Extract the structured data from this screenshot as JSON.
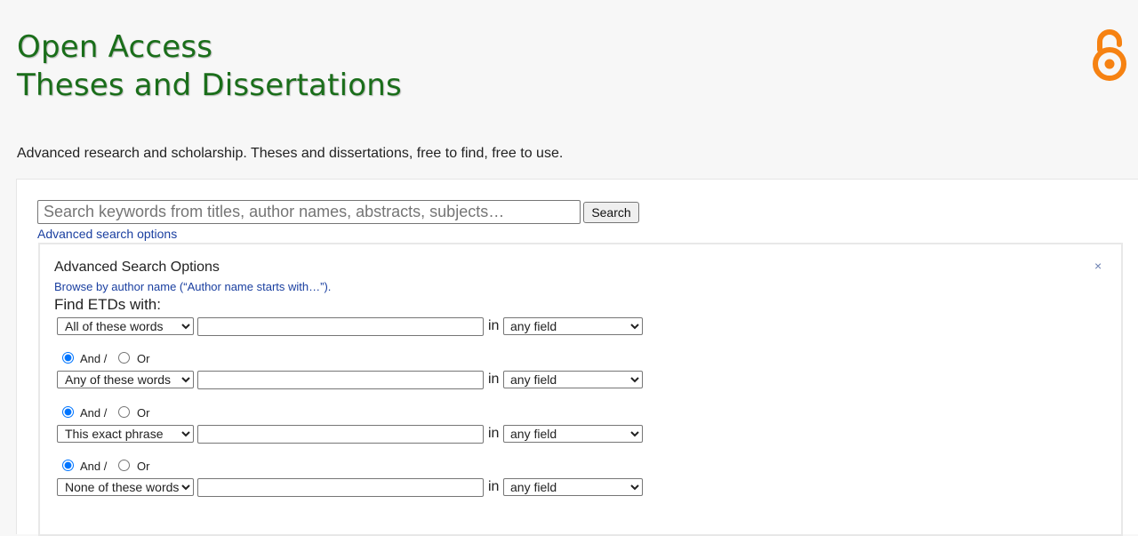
{
  "header": {
    "title_line1": "Open Access",
    "title_line2": "Theses and Dissertations",
    "logo_icon": "open-access-lock-icon",
    "logo_color": "#f68212",
    "title_color": "#1a6e1a"
  },
  "tagline": "Advanced research and scholarship. Theses and dissertations, free to find, free to use.",
  "search": {
    "placeholder": "Search keywords from titles, author names, abstracts, subjects…",
    "value": "",
    "button_label": "Search",
    "advanced_link": "Advanced search options"
  },
  "advanced": {
    "heading": "Advanced Search Options",
    "close_label": "×",
    "browse_link": "Browse by author name (“Author name starts with…”).",
    "find_label": "Find ETDs with:",
    "in_label": "in",
    "and_label": "And /",
    "or_label": "Or",
    "rows": [
      {
        "type": "All of these words",
        "value": "",
        "field": "any field"
      },
      {
        "type": "Any of these words",
        "value": "",
        "field": "any field"
      },
      {
        "type": "This exact phrase",
        "value": "",
        "field": "any field"
      },
      {
        "type": "None of these words",
        "value": "",
        "field": "any field"
      }
    ],
    "connectors": [
      {
        "selected": "and"
      },
      {
        "selected": "and"
      },
      {
        "selected": "and"
      }
    ]
  }
}
